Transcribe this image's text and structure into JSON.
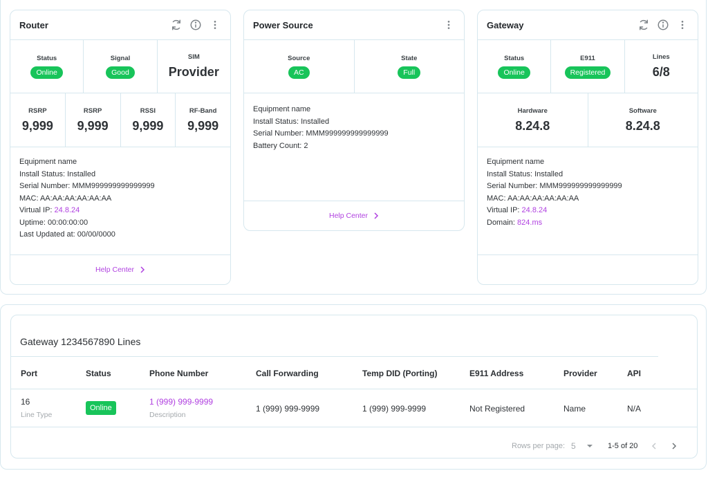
{
  "router": {
    "title": "Router",
    "stats_top": [
      {
        "label": "Status",
        "value": "Online",
        "kind": "pill"
      },
      {
        "label": "Signal",
        "value": "Good",
        "kind": "pill"
      },
      {
        "label": "SIM",
        "value": "Provider",
        "kind": "text"
      }
    ],
    "stats_bottom": [
      {
        "label": "RSRP",
        "value": "9,999"
      },
      {
        "label": "RSRP",
        "value": "9,999"
      },
      {
        "label": "RSSI",
        "value": "9,999"
      },
      {
        "label": "RF-Band",
        "value": "9,999"
      }
    ],
    "info": {
      "equipment": "Equipment name",
      "install_status": "Install Status: Installed",
      "serial": "Serial Number: MMM999999999999999",
      "mac": "MAC: AA:AA:AA:AA:AA:AA",
      "virtual_ip_label": "Virtual IP: ",
      "virtual_ip": "24.8.24",
      "uptime": "Uptime: 00:00:00:00",
      "last_updated": "Last Updated at: 00/00/0000"
    },
    "help": "Help Center"
  },
  "power": {
    "title": "Power Source",
    "stats": [
      {
        "label": "Source",
        "value": "AC"
      },
      {
        "label": "State",
        "value": "Full"
      }
    ],
    "info": {
      "equipment": "Equipment name",
      "install_status": "Install Status: Installed",
      "serial": "Serial Number: MMM999999999999999",
      "battery": "Battery Count: 2"
    },
    "help": "Help Center"
  },
  "gateway": {
    "title": "Gateway",
    "stats_top": [
      {
        "label": "Status",
        "value": "Online",
        "kind": "pill"
      },
      {
        "label": "E911",
        "value": "Registered",
        "kind": "pill"
      },
      {
        "label": "Lines",
        "value": "6/8",
        "kind": "text"
      }
    ],
    "stats_bottom": [
      {
        "label": "Hardware",
        "value": "8.24.8"
      },
      {
        "label": "Software",
        "value": "8.24.8"
      }
    ],
    "info": {
      "equipment": "Equipment name",
      "install_status": "Install Status: Installed",
      "serial": "Serial Number: MMM999999999999999",
      "mac": "MAC: AA:AA:AA:AA:AA:AA",
      "virtual_ip_label": "Virtual IP: ",
      "virtual_ip": "24.8.24",
      "domain_label": "Domain: ",
      "domain": "824.ms"
    }
  },
  "lines_table": {
    "title": "Gateway 1234567890 Lines",
    "columns": [
      "Port",
      "Status",
      "Phone Number",
      "Call Forwarding",
      "Temp DID (Porting)",
      "E911 Address",
      "Provider",
      "API"
    ],
    "row": {
      "port": "16",
      "line_type": "Line Type",
      "status": "Online",
      "phone": "1 (999) 999-9999",
      "description": "Description",
      "call_forwarding": "1 (999) 999-9999",
      "temp_did": "1 (999) 999-9999",
      "e911": "Not Registered",
      "provider": "Name",
      "api": "N/A"
    },
    "pagination": {
      "rows_per_page_label": "Rows per page:",
      "rows_per_page": "5",
      "range": "1-5 of 20"
    }
  },
  "colors": {
    "accent": "#b040e0",
    "success": "#18c45a",
    "border": "#d6e7ee"
  },
  "icons": [
    "refresh-icon",
    "info-icon",
    "more-vertical-icon",
    "chevron-right-icon",
    "chevron-down-icon",
    "chevron-left-icon"
  ]
}
